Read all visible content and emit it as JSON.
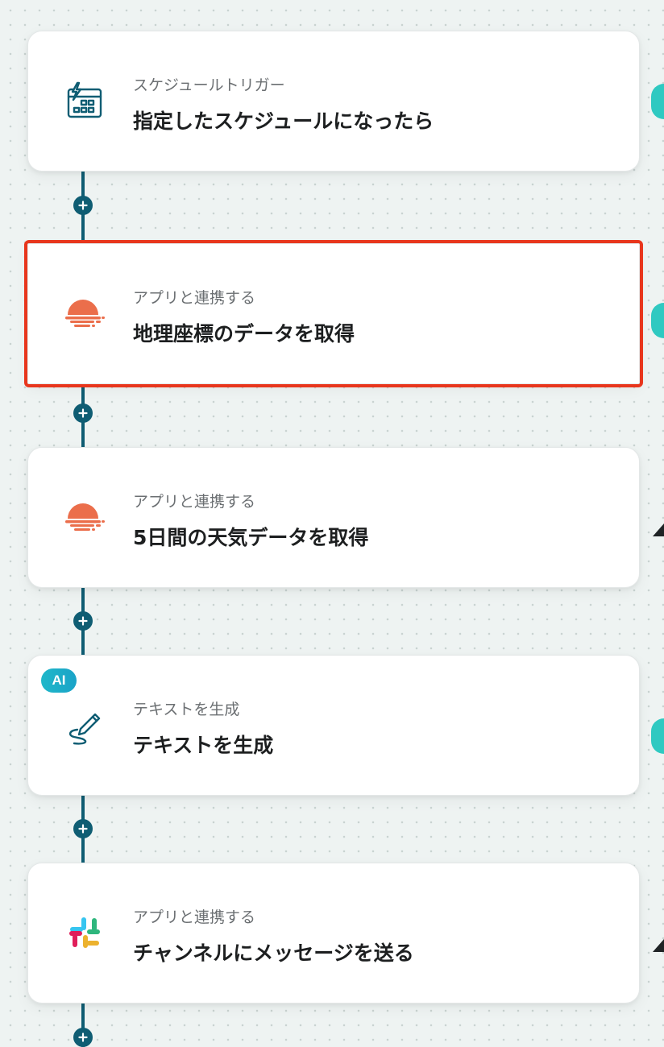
{
  "flow": {
    "steps": [
      {
        "subtitle": "スケジュールトリガー",
        "title": "指定したスケジュールになったら",
        "icon": "schedule-calendar-icon"
      },
      {
        "subtitle": "アプリと連携する",
        "title": "地理座標のデータを取得",
        "icon": "openweather-icon",
        "selected": true
      },
      {
        "subtitle": "アプリと連携する",
        "title": "5日間の天気データを取得",
        "icon": "openweather-icon"
      },
      {
        "subtitle": "テキストを生成",
        "title": "テキストを生成",
        "icon": "pen-text-icon",
        "badge": "AI"
      },
      {
        "subtitle": "アプリと連携する",
        "title": "チャンネルにメッセージを送る",
        "icon": "slack-icon"
      }
    ]
  },
  "colors": {
    "connector": "#0f5d73",
    "selection": "#e8361d",
    "openweather": "#eb6e4b",
    "ai_badge": "#1fb7c9",
    "side_tab": "#2fc9c1"
  }
}
